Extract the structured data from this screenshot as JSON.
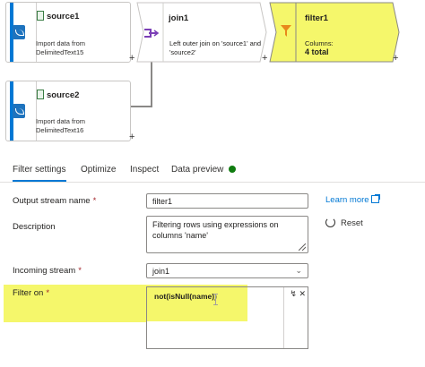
{
  "flow": {
    "source1": {
      "title": "source1",
      "desc_line1": "Import data from",
      "desc_line2": "DelimitedText15"
    },
    "source2": {
      "title": "source2",
      "desc_line1": "Import data from",
      "desc_line2": "DelimitedText16"
    },
    "join1": {
      "title": "join1",
      "desc_line1": "Left outer join on 'source1' and",
      "desc_line2": "'source2'"
    },
    "filter1": {
      "title": "filter1",
      "columns_label": "Columns:",
      "columns_value": "4 total"
    },
    "add_symbol": "+"
  },
  "tabs": [
    {
      "label": "Filter settings",
      "active": true
    },
    {
      "label": "Optimize",
      "active": false
    },
    {
      "label": "Inspect",
      "active": false
    },
    {
      "label": "Data preview",
      "active": false
    }
  ],
  "form": {
    "output_stream": {
      "label": "Output stream name",
      "required": "*",
      "value": "filter1"
    },
    "description": {
      "label": "Description",
      "value_line1": "Filtering rows using expressions on",
      "value_line2": "columns 'name'"
    },
    "incoming_stream": {
      "label": "Incoming stream",
      "required": "*",
      "value": "join1"
    },
    "filter_on": {
      "label": "Filter on",
      "required": "*",
      "expression": "not(isNull(name))"
    }
  },
  "actions": {
    "learn_more": "Learn more",
    "reset": "Reset"
  },
  "colors": {
    "accent": "#0078d4",
    "highlight": "#f5f76b",
    "status_ok": "#107c10"
  },
  "icons": [
    "source-icon",
    "join-icon",
    "filter-icon",
    "external-link-icon",
    "reset-icon",
    "chevron-down-icon",
    "expression-builder-icon",
    "close-icon"
  ]
}
